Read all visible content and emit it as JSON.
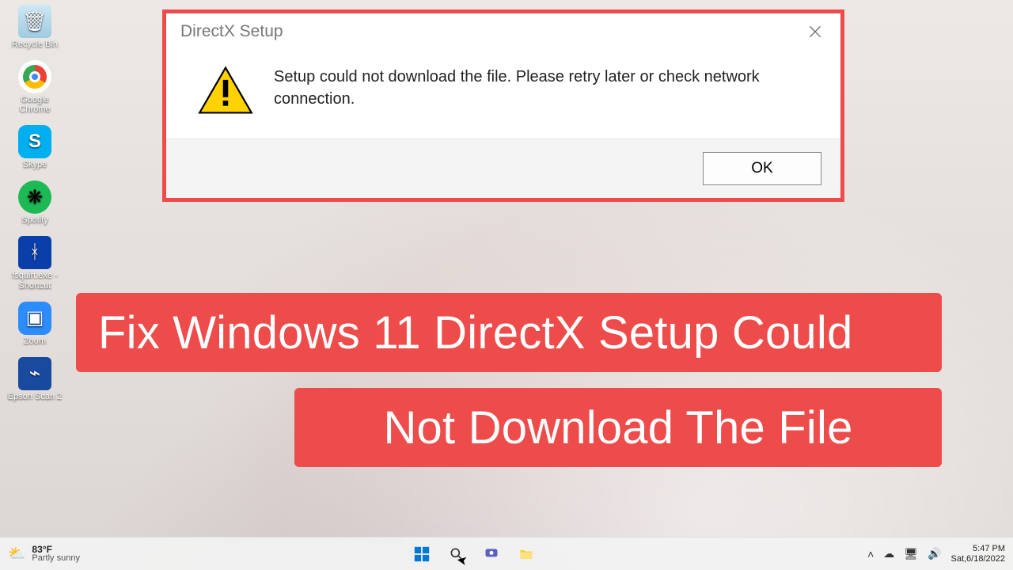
{
  "desktop_icons": [
    {
      "label": "Recycle Bin",
      "glyph": "🗑"
    },
    {
      "label": "Google Chrome",
      "glyph": ""
    },
    {
      "label": "Skype",
      "glyph": "S"
    },
    {
      "label": "Spotify",
      "glyph": "❋"
    },
    {
      "label": "fsquirt.exe - Shortcut",
      "glyph": "ᚼ"
    },
    {
      "label": "Zoom",
      "glyph": "▣"
    },
    {
      "label": "Epson Scan 2",
      "glyph": "⌁"
    }
  ],
  "dialog": {
    "title": "DirectX Setup",
    "message": "Setup could not download the file. Please retry later or check network connection.",
    "ok_label": "OK"
  },
  "overlay": {
    "line1": "Fix Windows 11 DirectX Setup Could",
    "line2": "Not Download The File"
  },
  "taskbar": {
    "weather_temp": "83°F",
    "weather_text": "Partly sunny",
    "time": "5:47 PM",
    "date": "Sat,6/18/2022"
  }
}
